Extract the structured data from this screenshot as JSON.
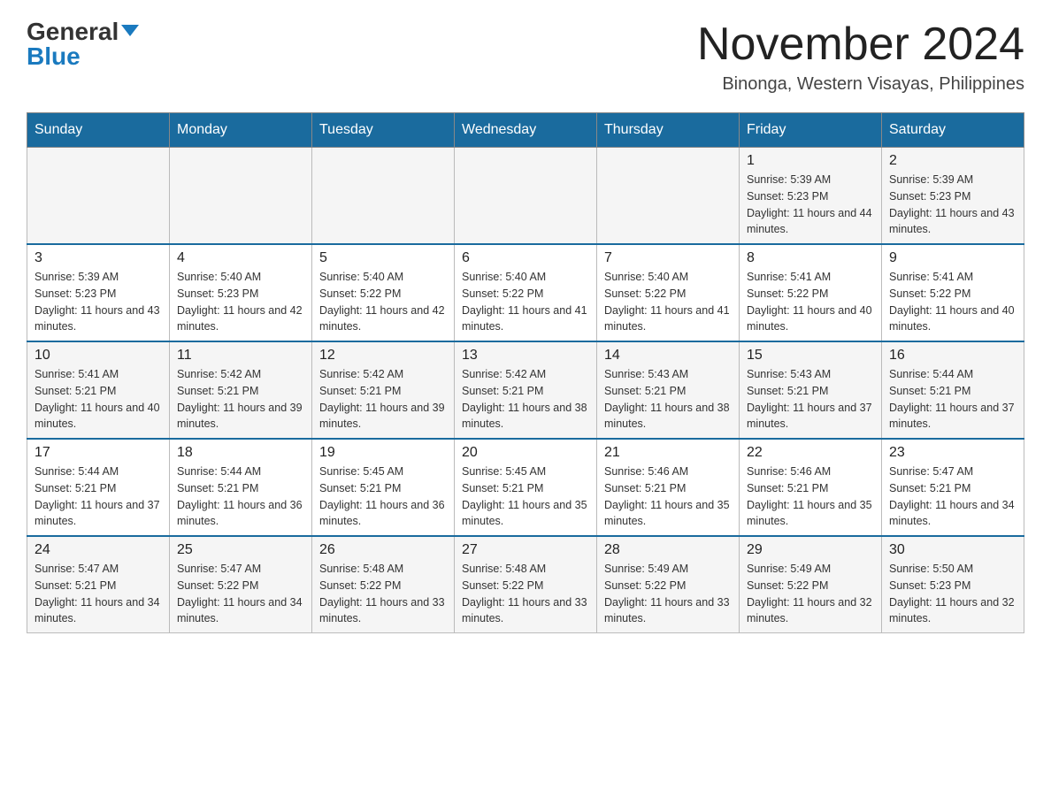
{
  "logo": {
    "general": "General",
    "arrow": "▼",
    "blue": "Blue"
  },
  "header": {
    "month_title": "November 2024",
    "location": "Binonga, Western Visayas, Philippines"
  },
  "weekdays": [
    "Sunday",
    "Monday",
    "Tuesday",
    "Wednesday",
    "Thursday",
    "Friday",
    "Saturday"
  ],
  "weeks": [
    [
      {
        "day": "",
        "sunrise": "",
        "sunset": "",
        "daylight": ""
      },
      {
        "day": "",
        "sunrise": "",
        "sunset": "",
        "daylight": ""
      },
      {
        "day": "",
        "sunrise": "",
        "sunset": "",
        "daylight": ""
      },
      {
        "day": "",
        "sunrise": "",
        "sunset": "",
        "daylight": ""
      },
      {
        "day": "",
        "sunrise": "",
        "sunset": "",
        "daylight": ""
      },
      {
        "day": "1",
        "sunrise": "Sunrise: 5:39 AM",
        "sunset": "Sunset: 5:23 PM",
        "daylight": "Daylight: 11 hours and 44 minutes."
      },
      {
        "day": "2",
        "sunrise": "Sunrise: 5:39 AM",
        "sunset": "Sunset: 5:23 PM",
        "daylight": "Daylight: 11 hours and 43 minutes."
      }
    ],
    [
      {
        "day": "3",
        "sunrise": "Sunrise: 5:39 AM",
        "sunset": "Sunset: 5:23 PM",
        "daylight": "Daylight: 11 hours and 43 minutes."
      },
      {
        "day": "4",
        "sunrise": "Sunrise: 5:40 AM",
        "sunset": "Sunset: 5:23 PM",
        "daylight": "Daylight: 11 hours and 42 minutes."
      },
      {
        "day": "5",
        "sunrise": "Sunrise: 5:40 AM",
        "sunset": "Sunset: 5:22 PM",
        "daylight": "Daylight: 11 hours and 42 minutes."
      },
      {
        "day": "6",
        "sunrise": "Sunrise: 5:40 AM",
        "sunset": "Sunset: 5:22 PM",
        "daylight": "Daylight: 11 hours and 41 minutes."
      },
      {
        "day": "7",
        "sunrise": "Sunrise: 5:40 AM",
        "sunset": "Sunset: 5:22 PM",
        "daylight": "Daylight: 11 hours and 41 minutes."
      },
      {
        "day": "8",
        "sunrise": "Sunrise: 5:41 AM",
        "sunset": "Sunset: 5:22 PM",
        "daylight": "Daylight: 11 hours and 40 minutes."
      },
      {
        "day": "9",
        "sunrise": "Sunrise: 5:41 AM",
        "sunset": "Sunset: 5:22 PM",
        "daylight": "Daylight: 11 hours and 40 minutes."
      }
    ],
    [
      {
        "day": "10",
        "sunrise": "Sunrise: 5:41 AM",
        "sunset": "Sunset: 5:21 PM",
        "daylight": "Daylight: 11 hours and 40 minutes."
      },
      {
        "day": "11",
        "sunrise": "Sunrise: 5:42 AM",
        "sunset": "Sunset: 5:21 PM",
        "daylight": "Daylight: 11 hours and 39 minutes."
      },
      {
        "day": "12",
        "sunrise": "Sunrise: 5:42 AM",
        "sunset": "Sunset: 5:21 PM",
        "daylight": "Daylight: 11 hours and 39 minutes."
      },
      {
        "day": "13",
        "sunrise": "Sunrise: 5:42 AM",
        "sunset": "Sunset: 5:21 PM",
        "daylight": "Daylight: 11 hours and 38 minutes."
      },
      {
        "day": "14",
        "sunrise": "Sunrise: 5:43 AM",
        "sunset": "Sunset: 5:21 PM",
        "daylight": "Daylight: 11 hours and 38 minutes."
      },
      {
        "day": "15",
        "sunrise": "Sunrise: 5:43 AM",
        "sunset": "Sunset: 5:21 PM",
        "daylight": "Daylight: 11 hours and 37 minutes."
      },
      {
        "day": "16",
        "sunrise": "Sunrise: 5:44 AM",
        "sunset": "Sunset: 5:21 PM",
        "daylight": "Daylight: 11 hours and 37 minutes."
      }
    ],
    [
      {
        "day": "17",
        "sunrise": "Sunrise: 5:44 AM",
        "sunset": "Sunset: 5:21 PM",
        "daylight": "Daylight: 11 hours and 37 minutes."
      },
      {
        "day": "18",
        "sunrise": "Sunrise: 5:44 AM",
        "sunset": "Sunset: 5:21 PM",
        "daylight": "Daylight: 11 hours and 36 minutes."
      },
      {
        "day": "19",
        "sunrise": "Sunrise: 5:45 AM",
        "sunset": "Sunset: 5:21 PM",
        "daylight": "Daylight: 11 hours and 36 minutes."
      },
      {
        "day": "20",
        "sunrise": "Sunrise: 5:45 AM",
        "sunset": "Sunset: 5:21 PM",
        "daylight": "Daylight: 11 hours and 35 minutes."
      },
      {
        "day": "21",
        "sunrise": "Sunrise: 5:46 AM",
        "sunset": "Sunset: 5:21 PM",
        "daylight": "Daylight: 11 hours and 35 minutes."
      },
      {
        "day": "22",
        "sunrise": "Sunrise: 5:46 AM",
        "sunset": "Sunset: 5:21 PM",
        "daylight": "Daylight: 11 hours and 35 minutes."
      },
      {
        "day": "23",
        "sunrise": "Sunrise: 5:47 AM",
        "sunset": "Sunset: 5:21 PM",
        "daylight": "Daylight: 11 hours and 34 minutes."
      }
    ],
    [
      {
        "day": "24",
        "sunrise": "Sunrise: 5:47 AM",
        "sunset": "Sunset: 5:21 PM",
        "daylight": "Daylight: 11 hours and 34 minutes."
      },
      {
        "day": "25",
        "sunrise": "Sunrise: 5:47 AM",
        "sunset": "Sunset: 5:22 PM",
        "daylight": "Daylight: 11 hours and 34 minutes."
      },
      {
        "day": "26",
        "sunrise": "Sunrise: 5:48 AM",
        "sunset": "Sunset: 5:22 PM",
        "daylight": "Daylight: 11 hours and 33 minutes."
      },
      {
        "day": "27",
        "sunrise": "Sunrise: 5:48 AM",
        "sunset": "Sunset: 5:22 PM",
        "daylight": "Daylight: 11 hours and 33 minutes."
      },
      {
        "day": "28",
        "sunrise": "Sunrise: 5:49 AM",
        "sunset": "Sunset: 5:22 PM",
        "daylight": "Daylight: 11 hours and 33 minutes."
      },
      {
        "day": "29",
        "sunrise": "Sunrise: 5:49 AM",
        "sunset": "Sunset: 5:22 PM",
        "daylight": "Daylight: 11 hours and 32 minutes."
      },
      {
        "day": "30",
        "sunrise": "Sunrise: 5:50 AM",
        "sunset": "Sunset: 5:23 PM",
        "daylight": "Daylight: 11 hours and 32 minutes."
      }
    ]
  ]
}
